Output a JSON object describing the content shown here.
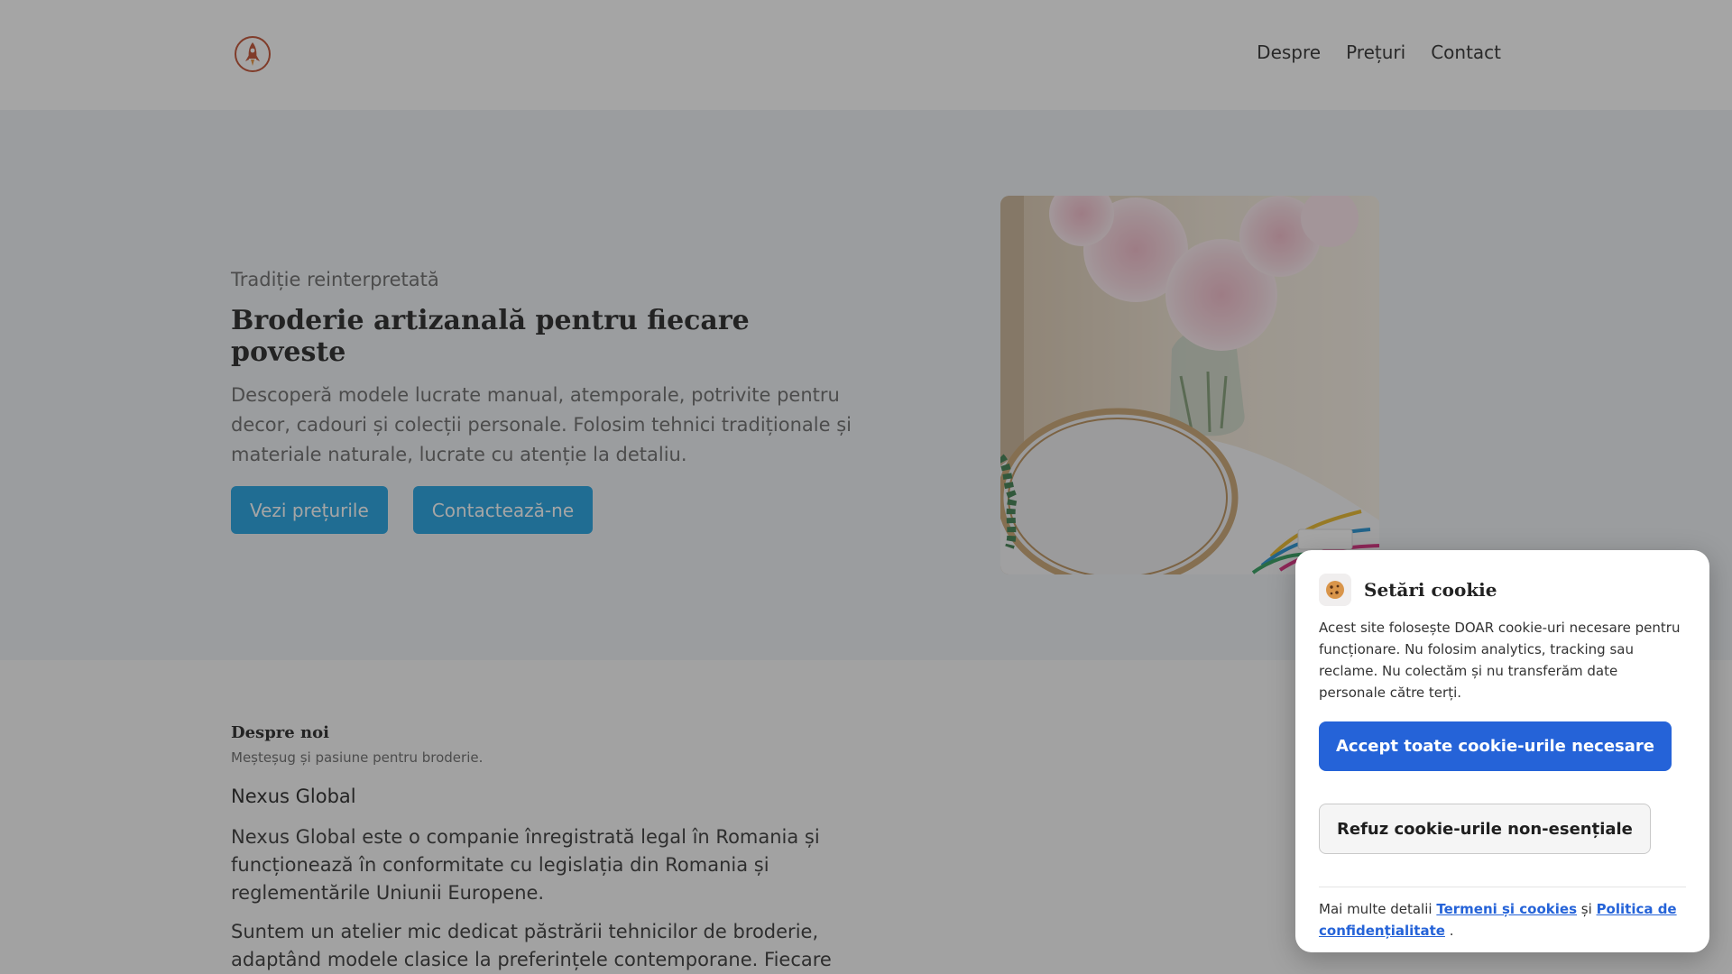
{
  "header": {
    "logo_icon": "rocket-emblem-icon",
    "nav": [
      {
        "label": "Despre"
      },
      {
        "label": "Prețuri"
      },
      {
        "label": "Contact"
      }
    ]
  },
  "hero": {
    "eyebrow": "Tradiție reinterpretată",
    "title": "Broderie artizanală pentru fiecare poveste",
    "description": "Descoperă modele lucrate manual, atemporale, potrivite pentru decor, cadouri și colecții personale. Folosim tehnici tradiționale și materiale naturale, lucrate cu atenție la detaliu.",
    "buttons": {
      "prices": "Vezi prețurile",
      "contact": "Contactează-ne"
    },
    "image": "peonies-embroidery-hoop-photo"
  },
  "about": {
    "heading": "Despre noi",
    "subheading": "Meșteșug și pasiune pentru broderie.",
    "company": "Nexus Global",
    "paragraph1": "Nexus Global este o companie înregistrată legal în Romania și funcționează în conformitate cu legislația din Romania și reglementările Uniunii Europene.",
    "paragraph2": "Suntem un atelier mic dedicat păstrării tehnicilor de broderie, adaptând modele clasice la preferințele contemporane. Fiecare"
  },
  "cookie": {
    "icon": "cookie-icon",
    "title": "Setări cookie",
    "text": "Acest site folosește DOAR cookie-uri necesare pentru funcționare. Nu folosim analytics, tracking sau reclame. Nu colectăm și nu transferăm date personale către terți.",
    "accept_label": "Accept toate cookie-urile necesare",
    "refuse_label": "Refuz cookie-urile non-esențiale",
    "more_prefix": "Mai multe detalii",
    "terms_link": "Termeni și cookies",
    "and_word": "și",
    "privacy_link": "Politica de confidențialitate",
    "end": "."
  },
  "colors": {
    "accent": "#1a9fe0",
    "cookie_primary": "#2563d8",
    "logo": "#c04a2b"
  }
}
